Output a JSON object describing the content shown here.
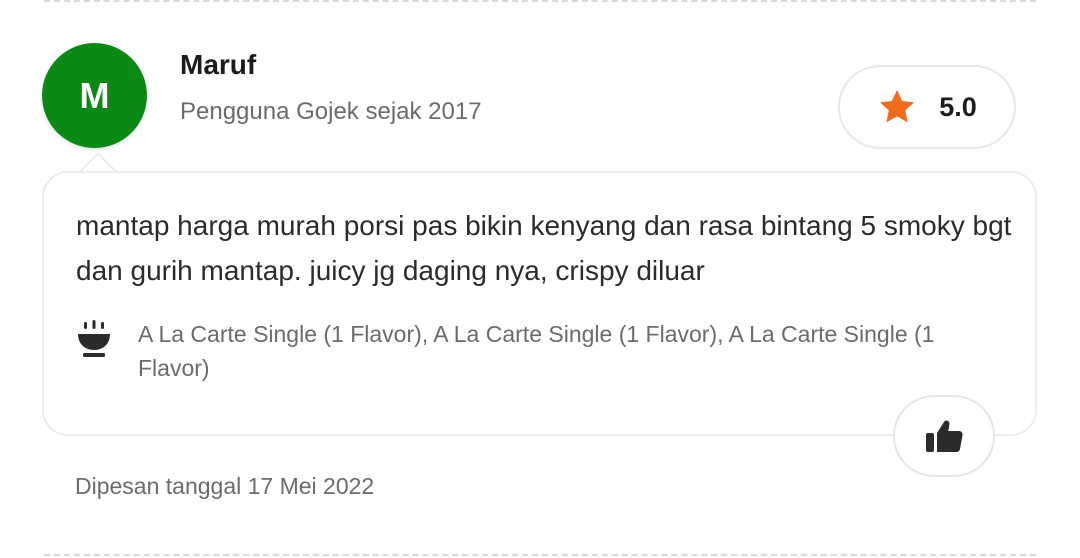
{
  "colors": {
    "avatar_bg": "#0a8a15",
    "star": "#f26b1d",
    "icon_dark": "#2b2b2b"
  },
  "reviewer": {
    "initial": "M",
    "name": "Maruf",
    "since": "Pengguna Gojek sejak 2017"
  },
  "rating": {
    "icon": "star-icon",
    "value": "5.0"
  },
  "review": {
    "text": "mantap harga murah porsi pas bikin kenyang dan rasa bintang 5 smoky bgt dan gurih mantap. juicy jg daging nya, crispy diluar",
    "items_icon": "bowl-icon",
    "items": "A La Carte Single (1 Flavor), A La Carte Single (1 Flavor), A La Carte Single (1 Flavor)"
  },
  "like_button": {
    "icon": "thumbs-up-icon"
  },
  "order_date": "Dipesan tanggal 17 Mei 2022"
}
